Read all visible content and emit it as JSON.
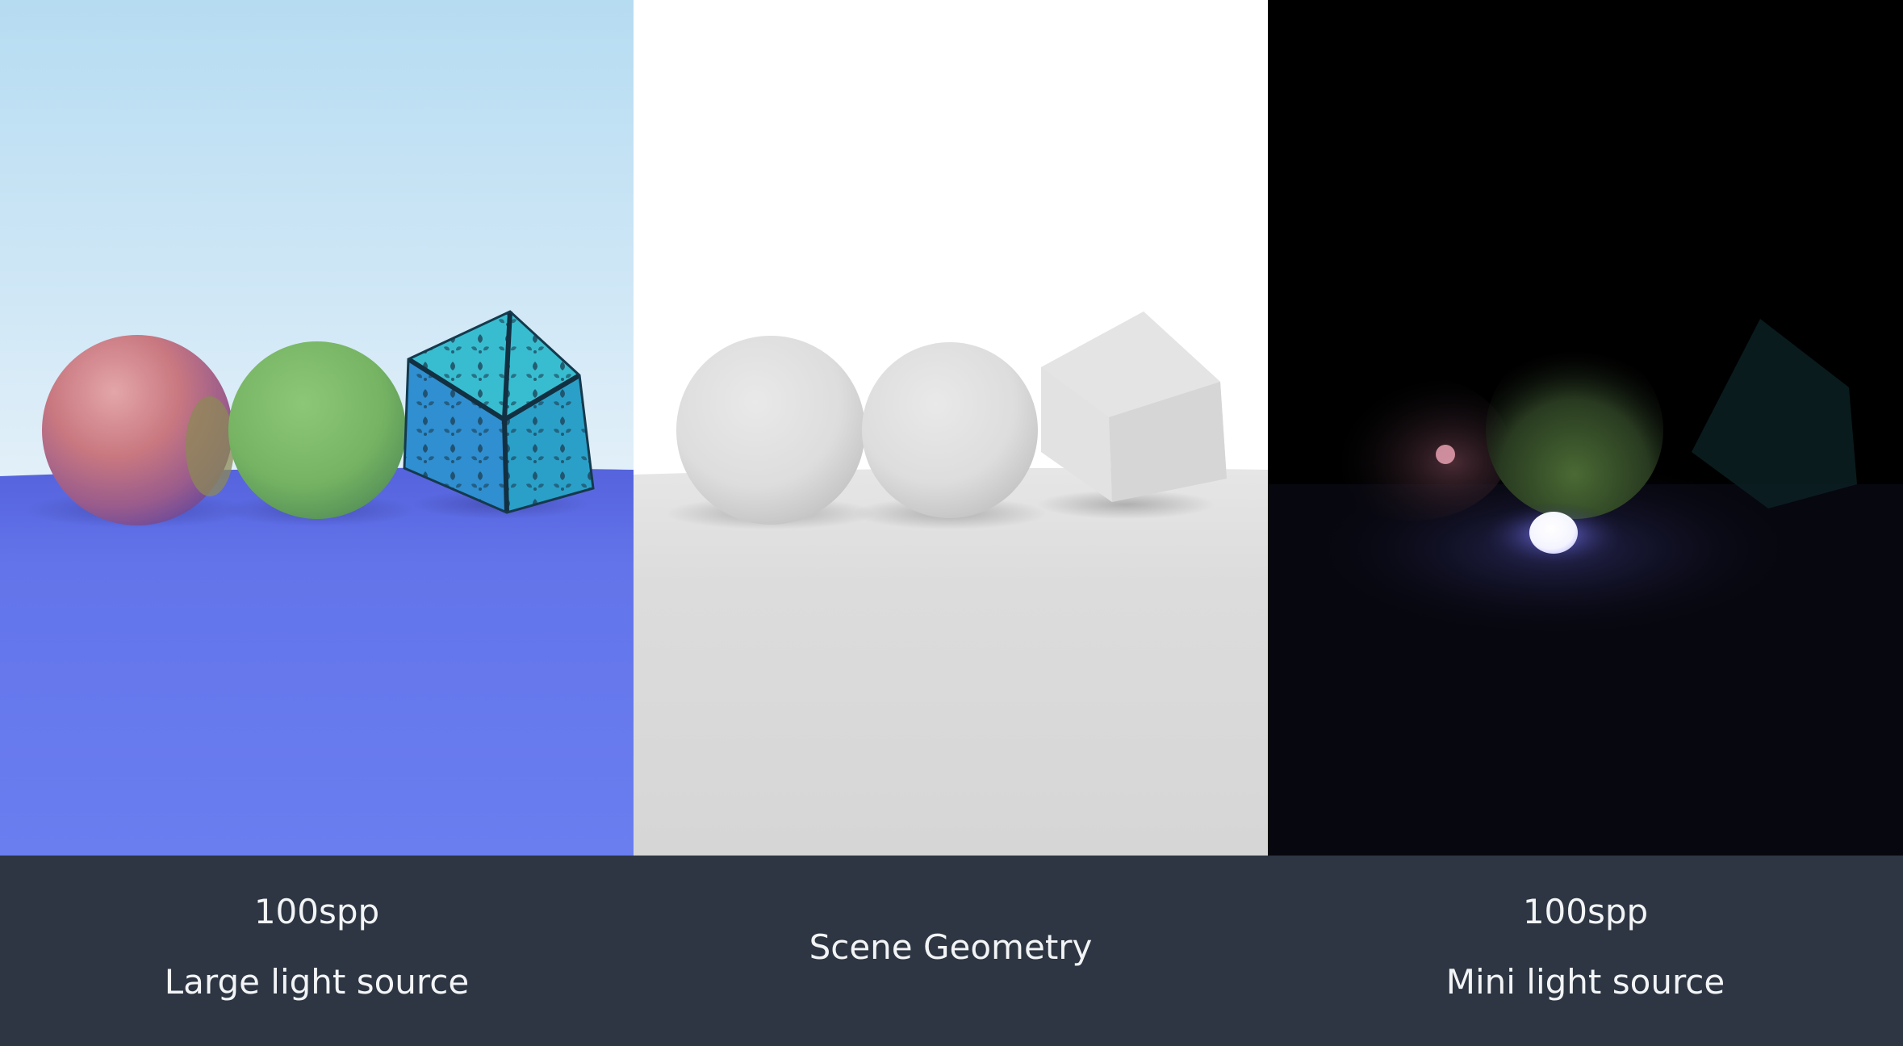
{
  "panels": [
    {
      "id": "left",
      "image": "Render with a large light source: pink metallic sphere, green diffuse sphere and teal ornamental-textured cube on a blue floor under a light blue sky",
      "caption": {
        "spp": "100spp",
        "label": "Large light source"
      }
    },
    {
      "id": "middle",
      "image": "Grey clay render of the scene geometry: two spheres and a cube on a white ground",
      "caption": {
        "label": "Scene Geometry"
      }
    },
    {
      "id": "right",
      "image": "Dark render lit by a small glowing white light sphere, objects faintly visible",
      "caption": {
        "spp": "100spp",
        "label": "Mini light source"
      }
    }
  ],
  "colors": {
    "caption_bar": "#2d3642",
    "caption_text": "#f2f4f6",
    "sky_top": "#b6dcf2",
    "sky_bottom": "#e3f0f9",
    "floor_blue": "#6a7ef0",
    "sphere_pink": "#c9747f",
    "sphere_green": "#7eb86a",
    "cube_teal": "#35b9c9",
    "geometry_grey": "#dddddd"
  }
}
